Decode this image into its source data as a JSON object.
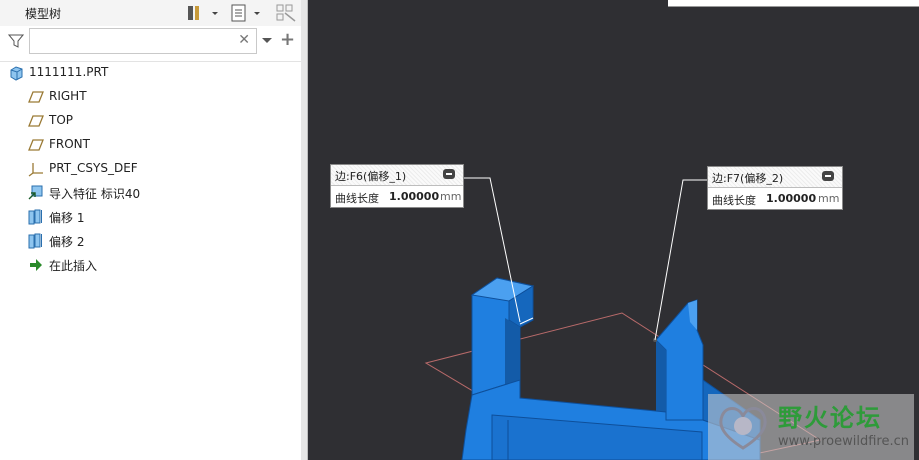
{
  "model_tree": {
    "title": "模型树",
    "search": {
      "placeholder": "",
      "value": ""
    },
    "items": [
      {
        "label": "1111111.PRT",
        "icon": "part-icon"
      },
      {
        "label": "RIGHT",
        "icon": "datum-plane-icon"
      },
      {
        "label": "TOP",
        "icon": "datum-plane-icon"
      },
      {
        "label": "FRONT",
        "icon": "datum-plane-icon"
      },
      {
        "label": "PRT_CSYS_DEF",
        "icon": "csys-icon"
      },
      {
        "label": "导入特征 标识40",
        "icon": "import-feature-icon"
      },
      {
        "label": "偏移 1",
        "icon": "offset-icon"
      },
      {
        "label": "偏移 2",
        "icon": "offset-icon"
      },
      {
        "label": "在此插入",
        "icon": "insert-here-arrow-icon"
      }
    ]
  },
  "callouts": [
    {
      "title": "边:F6(偏移_1)",
      "label": "曲线长度",
      "value": "1.00000",
      "unit": "mm"
    },
    {
      "title": "边:F7(偏移_2)",
      "label": "曲线长度",
      "value": "1.00000",
      "unit": "mm"
    }
  ],
  "watermark": {
    "name": "野火论坛",
    "url": "www.proewildfire.cn"
  },
  "colors": {
    "model_blue": "#1f7fe0",
    "viewport_bg": "#2f2f33",
    "watermark_green": "#2e9b3a"
  }
}
